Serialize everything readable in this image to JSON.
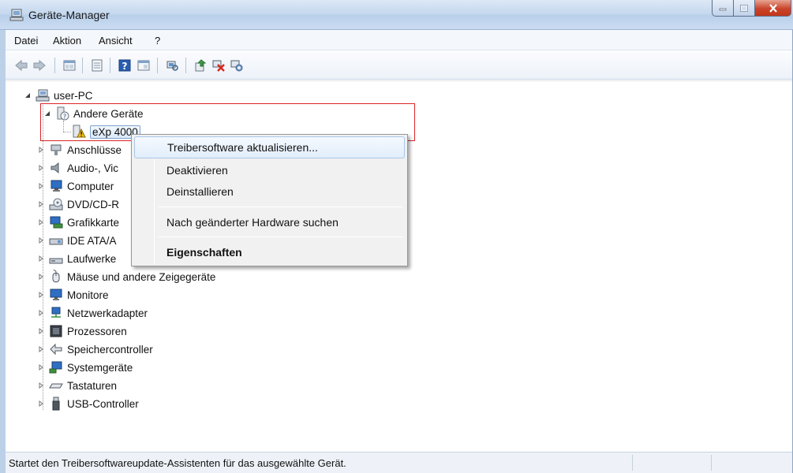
{
  "window": {
    "title": "Geräte-Manager",
    "icon": "device-manager-icon",
    "controls": [
      "minimize-icon",
      "maximize-icon",
      "close-icon"
    ]
  },
  "menubar": {
    "items": [
      "Datei",
      "Aktion",
      "Ansicht",
      "?"
    ]
  },
  "toolbar": {
    "buttons": [
      "back-icon",
      "forward-icon",
      "properties-view-icon",
      "list-view-icon",
      "help-icon",
      "console-tree-icon",
      "scan-hardware-icon",
      "update-driver-icon",
      "disable-device-icon",
      "uninstall-device-icon"
    ]
  },
  "tree": {
    "root": "user-PC",
    "other_devices": "Andere Geräte",
    "selected_device": "eXp 4000",
    "categories": [
      "Anschlüsse",
      "Audio-, Vic",
      "Computer",
      "DVD/CD-R",
      "Grafikkarte",
      "IDE ATA/A",
      "Laufwerke",
      "Mäuse und andere Zeigegeräte",
      "Monitore",
      "Netzwerkadapter",
      "Prozessoren",
      "Speichercontroller",
      "Systemgeräte",
      "Tastaturen",
      "USB-Controller"
    ]
  },
  "context_menu": {
    "items": [
      {
        "label": "Treibersoftware aktualisieren...",
        "hover": true
      },
      {
        "label": "Deaktivieren"
      },
      {
        "label": "Deinstallieren"
      },
      {
        "label": "Nach geänderter Hardware suchen"
      },
      {
        "label": "Eigenschaften",
        "bold": true
      }
    ]
  },
  "statusbar": {
    "text": "Startet den Treibersoftwareupdate-Assistenten für das ausgewählte Gerät."
  },
  "colors": {
    "highlight_border": "#d9252a",
    "selection_border": "#7da2ce",
    "titlebar": "#c4d7ee"
  }
}
